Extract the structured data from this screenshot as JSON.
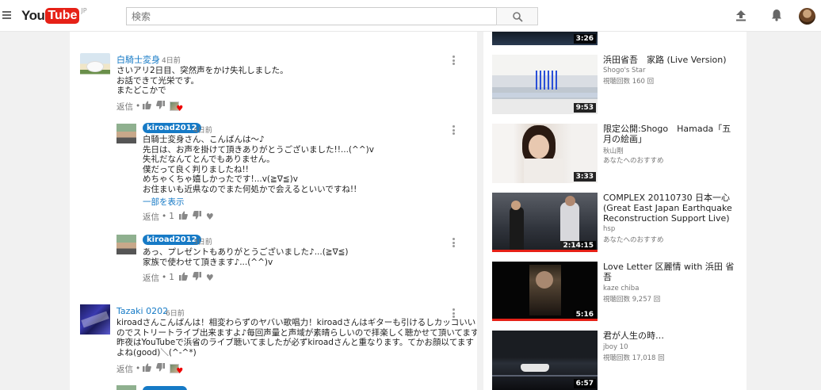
{
  "header": {
    "logo_you": "You",
    "logo_tube": "Tube",
    "logo_region": "JP",
    "search_placeholder": "検索"
  },
  "comments": [
    {
      "author": "白騎士変身",
      "time": "4日前",
      "text": "さいアリ2日目、突然声をかけ失礼しました。\nお話できて光栄です。\nまたどこかで",
      "reply_label": "返信",
      "dot": "•"
    },
    {
      "author": "kiroad2012",
      "time": "4日前",
      "text": "白騎士変身さん、こんばんは〜♪\n先日は、お声を掛けて頂きありがとうございました!!...(^^)v\n失礼だなんてとんでもありません。\n僕だって良く判りましたね!!\nめちゃくちゃ嬉しかったです!...v(≧∇≦)v\nお住まいも近県なのでまた何処かで会えるといいですね!!",
      "read_more": "一部を表示",
      "reply_label": "返信",
      "dot": "•",
      "likes": "1"
    },
    {
      "author": "kiroad2012",
      "time": "3日前",
      "text": "あっ、プレゼントもありがとうございました♪...(≧∇≦)\n家族で使わせて頂きます♪...(^^)v",
      "reply_label": "返信",
      "dot": "•",
      "likes": "1"
    },
    {
      "author": "Tazaki 0202",
      "time": "6日前",
      "text": "kiroadさんこんばんは！相変わらずのヤバい歌唱力！kiroadさんはギターも引けるしカッコいい\nのでストリートライブ出来ますよ♪毎回声量と声域が素晴らしいので拝楽しく聴かせて頂いてます♪\n昨夜はYouTubeで浜省のライブ聴いてましたが必ずkiroadさんと重なります。てかお顔以てます\nよね(good)＼(^-^*)",
      "reply_label": "返信",
      "dot": "•"
    }
  ],
  "related": [
    {
      "duration": "3:26"
    },
    {
      "title": "浜田省吾　家路 (Live Version)",
      "channel": "Shogo's Star",
      "meta": "視聴回数 160 回",
      "duration": "9:53"
    },
    {
      "title": "限定公開:Shogo　Hamada「五月の絵画」",
      "channel": "秋山剛",
      "meta": "あなたへのおすすめ",
      "duration": "3:33"
    },
    {
      "title": "COMPLEX 20110730 日本一心 (Great East Japan Earthquake Reconstruction Support Live)",
      "channel": "hsp",
      "meta": "あなたへのおすすめ",
      "duration": "2:14:15"
    },
    {
      "title": "Love Letter 区麗情 with 浜田 省吾",
      "channel": "kaze chiba",
      "meta": "視聴回数 9,257 回",
      "duration": "5:16"
    },
    {
      "title": "君が人生の時…",
      "channel": "jboy 10",
      "meta": "視聴回数 17,018 回",
      "duration": "6:57"
    }
  ]
}
